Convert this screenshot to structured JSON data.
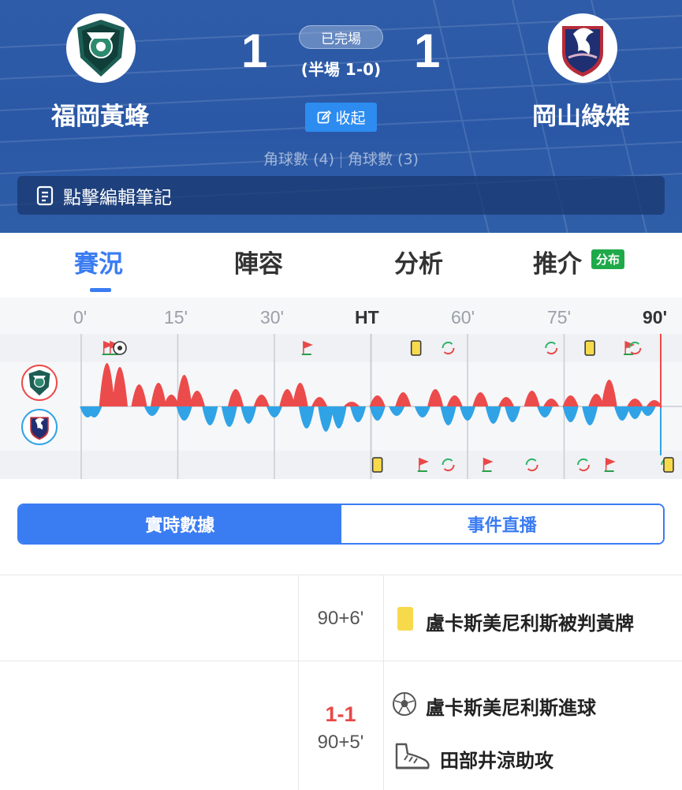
{
  "match": {
    "home": {
      "name": "福岡黃蜂",
      "score": "1",
      "corners": "角球數 (4)"
    },
    "away": {
      "name": "岡山綠雉",
      "score": "1",
      "corners": "角球數 (3)"
    },
    "status": "已完場",
    "halftime": "(半場 1-0)",
    "collapse_label": "收起",
    "notes_label": "點擊編輯筆記"
  },
  "tabs": [
    {
      "label": "賽況",
      "active": true
    },
    {
      "label": "陣容",
      "active": false
    },
    {
      "label": "分析",
      "active": false
    },
    {
      "label": "推介",
      "active": false
    }
  ],
  "tab_badge": "分布",
  "timeline": {
    "minute_labels": [
      "0'",
      "15'",
      "30'",
      "HT",
      "60'",
      "75'",
      "90'"
    ],
    "home_events": [
      {
        "minute": 4,
        "type": "corner"
      },
      {
        "minute": 5,
        "type": "corner"
      },
      {
        "minute": 6,
        "type": "goal"
      },
      {
        "minute": 35,
        "type": "corner"
      },
      {
        "minute": 52,
        "type": "yellow-card"
      },
      {
        "minute": 57,
        "type": "substitution"
      },
      {
        "minute": 73,
        "type": "substitution"
      },
      {
        "minute": 79,
        "type": "yellow-card"
      },
      {
        "minute": 85,
        "type": "corner"
      },
      {
        "minute": 86,
        "type": "substitution"
      }
    ],
    "away_events": [
      {
        "minute": 46,
        "type": "yellow-card"
      },
      {
        "minute": 53,
        "type": "corner"
      },
      {
        "minute": 57,
        "type": "substitution"
      },
      {
        "minute": 63,
        "type": "corner"
      },
      {
        "minute": 70,
        "type": "substitution"
      },
      {
        "minute": 78,
        "type": "substitution"
      },
      {
        "minute": 82,
        "type": "corner"
      },
      {
        "minute": 91,
        "type": "substitution"
      },
      {
        "minute": 92,
        "type": "yellow-card"
      }
    ],
    "colors": {
      "home": "#ec4b4b",
      "away": "#2fa3e6",
      "current_line": "#f04848"
    }
  },
  "segmented": {
    "realtime": "實時數據",
    "events": "事件直播"
  },
  "events": [
    {
      "time": "90+6'",
      "icon": "yellow-card-icon",
      "text": "盧卡斯美尼利斯被判黃牌"
    },
    {
      "time": "90+5'",
      "score": "1-1",
      "lines": [
        {
          "icon": "soccer-ball-icon",
          "text": "盧卡斯美尼利斯進球"
        },
        {
          "icon": "boot-icon",
          "text": "田部井涼助攻"
        }
      ]
    }
  ]
}
